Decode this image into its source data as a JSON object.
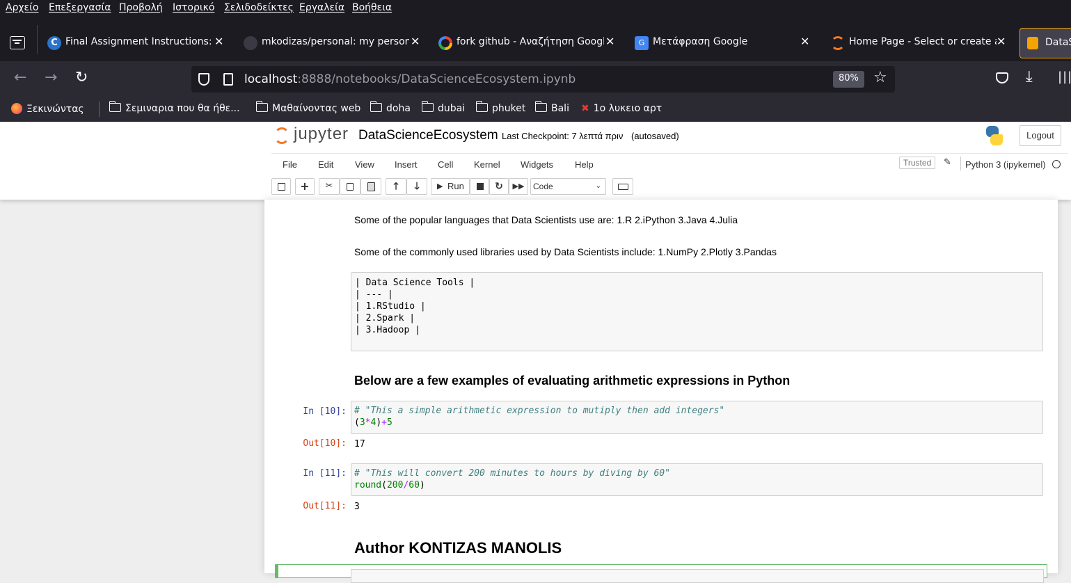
{
  "menubar": [
    "Αρχείο",
    "Επεξεργασία",
    "Προβολή",
    "Ιστορικό",
    "Σελιδοδείκτες",
    "Εργαλεία",
    "Βοήθεια"
  ],
  "tabs": [
    {
      "title": "Final Assignment Instructions: C"
    },
    {
      "title": "mkodizas/personal: my persona"
    },
    {
      "title": "fork github - Αναζήτηση Googl"
    },
    {
      "title": "Μετάφραση Google"
    },
    {
      "title": "Home Page - Select or create a"
    },
    {
      "title": "DataS"
    }
  ],
  "urlbar": {
    "host": "localhost",
    "path": ":8888/notebooks/DataScienceEcosystem.ipynb",
    "zoom": "80%"
  },
  "bookmarks": [
    "Ξεκινώντας",
    "Σεμιναρια που θα ήθε...",
    "Μαθαίνοντας web",
    "doha",
    "dubai",
    "phuket",
    "Bali",
    "1ο λυκειο αρτ"
  ],
  "jupyter": {
    "logo_text": "jupyter",
    "notebook_name": "DataScienceEcosystem",
    "checkpoint": "Last Checkpoint: 7 λεπτά πριν",
    "autosaved": "(autosaved)",
    "logout": "Logout",
    "menu": [
      "File",
      "Edit",
      "View",
      "Insert",
      "Cell",
      "Kernel",
      "Widgets",
      "Help"
    ],
    "trusted": "Trusted",
    "kernel": "Python 3 (ipykernel)",
    "run_label": "Run",
    "cell_type": "Code"
  },
  "cells": {
    "languages": "Some of the popular languages that Data Scientists use are: 1.R 2.iPython 3.Java 4.Julia",
    "libraries": "Some of the commonly used libraries used by Data Scientists include: 1.NumPy 2.Plotly 3.Pandas",
    "raw_lines": [
      "| Data Science Tools |",
      "| --- |",
      "| 1.RStudio |",
      "| 2.Spark |",
      "| 3.Hadoop |"
    ],
    "heading": "Below are a few examples of evaluating arithmetic expressions in Python",
    "in10_prompt": "In [10]:",
    "in10_comment": "# \"This a simple arithmetic expression to mutiply then add integers\"",
    "out10_prompt": "Out[10]:",
    "out10_value": "17",
    "in11_prompt": "In [11]:",
    "in11_comment": "# \"This will convert 200 minutes to hours by diving by 60\"",
    "out11_prompt": "Out[11]:",
    "out11_value": "3",
    "author": "Author KONTIZAS MANOLIS"
  },
  "colors": {
    "prompt_in": "#303f9f",
    "prompt_out": "#d84315",
    "selected_cell": "#66bb6a"
  }
}
